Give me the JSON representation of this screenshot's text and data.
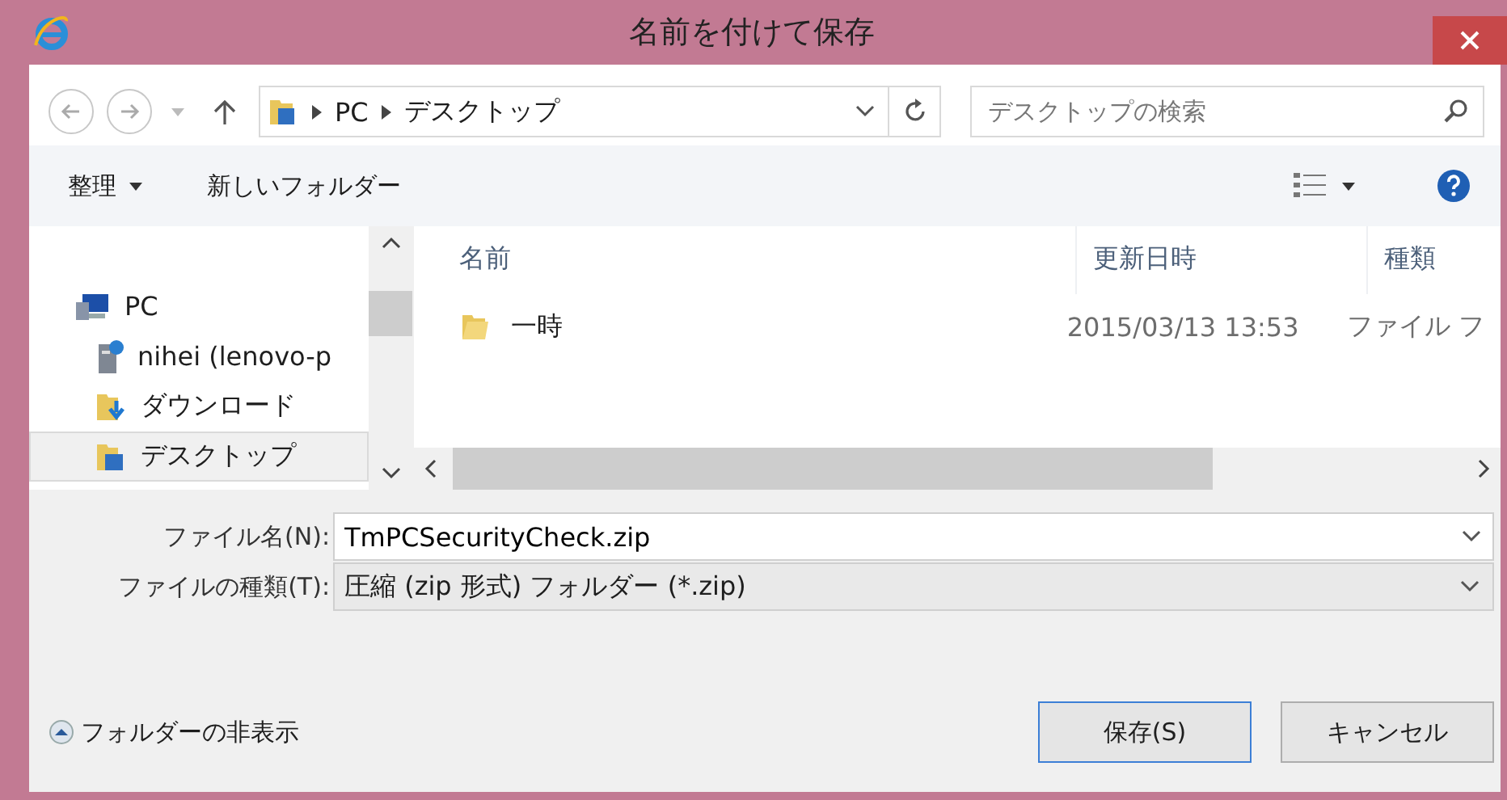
{
  "window": {
    "title": "名前を付けて保存"
  },
  "address": {
    "segments": [
      "PC",
      "デスクトップ"
    ]
  },
  "search": {
    "placeholder": "デスクトップの検索"
  },
  "toolbar": {
    "organize": "整理",
    "new_folder": "新しいフォルダー"
  },
  "nav_pane": {
    "items": [
      {
        "label": "PC",
        "kind": "pc",
        "selected": false,
        "children": [
          {
            "label": "nihei (lenovo-p",
            "kind": "drive",
            "selected": false
          },
          {
            "label": "ダウンロード",
            "kind": "downloads",
            "selected": false
          },
          {
            "label": "デスクトップ",
            "kind": "desktop",
            "selected": true
          }
        ]
      }
    ]
  },
  "file_list": {
    "columns": [
      "名前",
      "更新日時",
      "種類"
    ],
    "rows": [
      {
        "name": "一時",
        "modified": "2015/03/13 13:53",
        "type": "ファイル フ"
      }
    ]
  },
  "form": {
    "file_name": {
      "label": "ファイル名(N):",
      "value": "TmPCSecurityCheck.zip"
    },
    "file_type": {
      "label": "ファイルの種類(T):",
      "value": "圧縮 (zip 形式) フォルダー (*.zip)"
    }
  },
  "footer": {
    "hide_folders": "フォルダーの非表示",
    "save": "保存(S)",
    "cancel": "キャンセル"
  }
}
